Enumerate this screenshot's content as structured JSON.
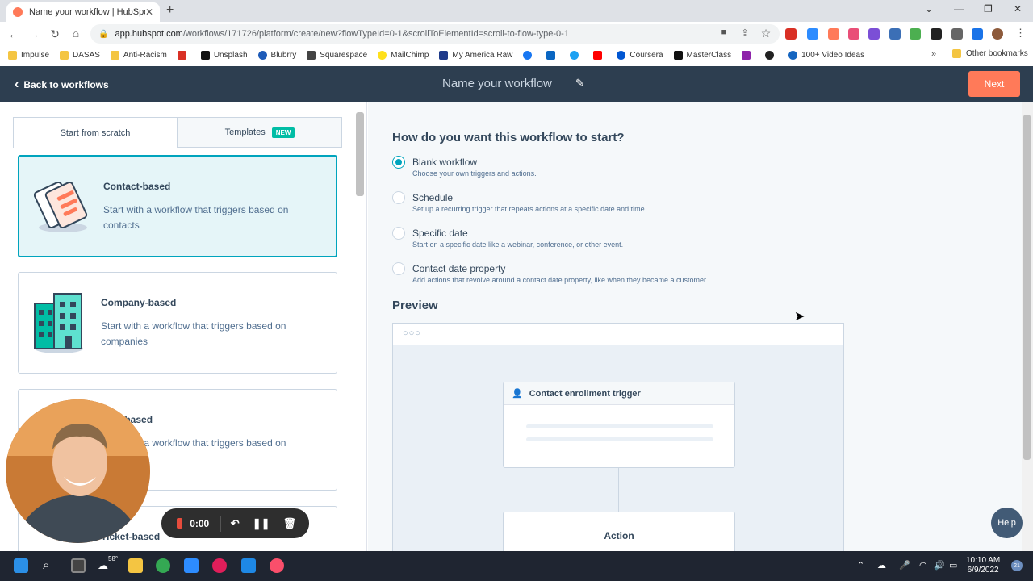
{
  "browser": {
    "tab_title": "Name your workflow | HubSpot",
    "url_domain": "app.hubspot.com",
    "url_path": "/workflows/171726/platform/create/new?flowTypeId=0-1&scrollToElementId=scroll-to-flow-type-0-1",
    "bookmarks": [
      "Impulse",
      "DASAS",
      "Anti-Racism",
      "Unsplash",
      "Blubrry",
      "Squarespace",
      "MailChimp",
      "My America Raw",
      "Coursera",
      "MasterClass",
      "100+ Video Ideas"
    ],
    "other_bookmarks": "Other bookmarks"
  },
  "header": {
    "back_label": "Back to workflows",
    "workflow_name": "Name your workflow",
    "next_label": "Next"
  },
  "left": {
    "tabs": [
      {
        "label": "Start from scratch"
      },
      {
        "label": "Templates",
        "badge": "NEW"
      }
    ],
    "cards": [
      {
        "title": "Contact-based",
        "desc": "Start with a workflow that triggers based on contacts"
      },
      {
        "title": "Company-based",
        "desc": "Start with a workflow that triggers based on companies"
      },
      {
        "title": "Deal-based",
        "desc": "Start with a workflow that triggers based on"
      },
      {
        "title": "Ticket-based"
      }
    ]
  },
  "main": {
    "question": "How do you want this workflow to start?",
    "options": [
      {
        "label": "Blank workflow",
        "desc": "Choose your own triggers and actions.",
        "selected": true
      },
      {
        "label": "Schedule",
        "desc": "Set up a recurring trigger that repeats actions at a specific date and time.",
        "selected": false
      },
      {
        "label": "Specific date",
        "desc": "Start on a specific date like a webinar, conference, or other event.",
        "selected": false
      },
      {
        "label": "Contact date property",
        "desc": "Add actions that revolve around a contact date property, like when they became a customer.",
        "selected": false
      }
    ],
    "preview_title": "Preview",
    "trigger_label": "Contact enrollment trigger",
    "action_label": "Action"
  },
  "help_label": "Help",
  "recorder": {
    "time": "0:00"
  },
  "taskbar": {
    "temperature": "58°",
    "time": "10:10 AM",
    "date": "6/9/2022",
    "notifications": "21"
  },
  "colors": {
    "brand": "#ff7a59",
    "accent": "#00a4bd",
    "nav": "#2d3e50"
  }
}
